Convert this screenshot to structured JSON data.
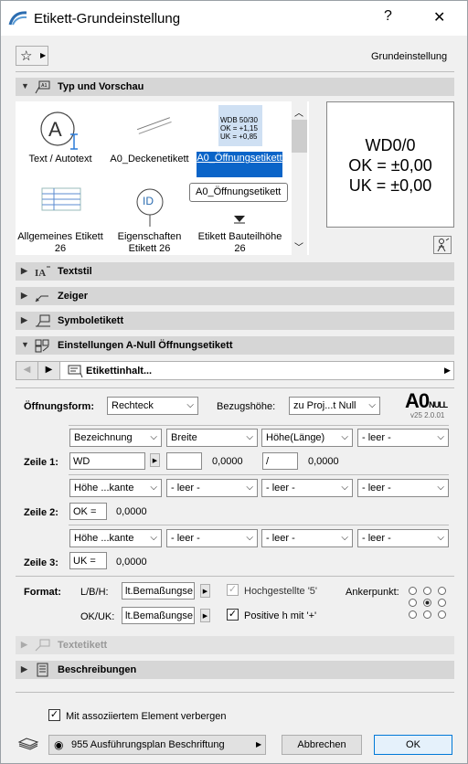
{
  "window": {
    "title": "Etikett-Grundeinstellung",
    "help": "?",
    "close": "✕"
  },
  "header": {
    "right_label": "Grundeinstellung"
  },
  "sections": {
    "typ": "Typ und Vorschau",
    "textstil": "Textstil",
    "zeiger": "Zeiger",
    "symbol": "Symboletikett",
    "anull": "Einstellungen A-Null Öffnungsetikett",
    "textetikett": "Textetikett",
    "beschreibungen": "Beschreibungen"
  },
  "library": {
    "items": [
      {
        "label": "Text / Autotext"
      },
      {
        "label": "A0_Deckenetikett"
      },
      {
        "label": "A0_Öffnungsetikett",
        "selected": true,
        "thumb_lines": [
          "WDB 50/30",
          "OK = +1,15",
          "UK = +0,85"
        ]
      },
      {
        "label": "Allgemeines Etikett 26"
      },
      {
        "label": "Eigenschaften Etikett 26",
        "thumb_text": "ID"
      },
      {
        "label": "Etikett Bauteilhöhe 26"
      }
    ],
    "tooltip": "A0_Öffnungsetikett"
  },
  "preview": {
    "lines": [
      "WD0/0",
      "OK = ±0,00",
      "UK = ±0,00"
    ]
  },
  "nav": {
    "label": "Etikettinhalt..."
  },
  "form": {
    "oeffnungsform_label": "Öffnungsform:",
    "oeffnungsform_value": "Rechteck",
    "bezugshoehe_label": "Bezugshöhe:",
    "bezugshoehe_value": "zu Proj...t Null",
    "logo_text": "A0",
    "logo_sub": "NULL",
    "version": "v25  2.0.01"
  },
  "rows": [
    {
      "label": "Zeile 1:",
      "selects": [
        "Bezeichnung",
        "Breite",
        "Höhe(Länge)",
        "- leer -"
      ],
      "input1": "WD",
      "input2": "",
      "value2": "0,0000",
      "input3": "/",
      "value3": "0,0000"
    },
    {
      "label": "Zeile 2:",
      "selects": [
        "Höhe ...kante",
        "- leer -",
        "- leer -",
        "- leer -"
      ],
      "input1": "OK =",
      "value1": "0,0000"
    },
    {
      "label": "Zeile 3:",
      "selects": [
        "Höhe ...kante",
        "- leer -",
        "- leer -",
        "- leer -"
      ],
      "input1": "UK =",
      "value1": "0,0000"
    }
  ],
  "format": {
    "label": "Format:",
    "lbh_label": "L/B/H:",
    "lbh_value": "lt.Bemaßungse",
    "okuk_label": "OK/UK:",
    "okuk_value": "lt.Bemaßungse",
    "hochgestellte": "Hochgestellte '5'",
    "positive": "Positive h mit '+'",
    "ankerpunkt": "Ankerpunkt:"
  },
  "footer": {
    "checkbox": "Mit assoziiertem Element verbergen",
    "layer": "955 Ausführungsplan Beschriftung",
    "cancel": "Abbrechen",
    "ok": "OK"
  }
}
